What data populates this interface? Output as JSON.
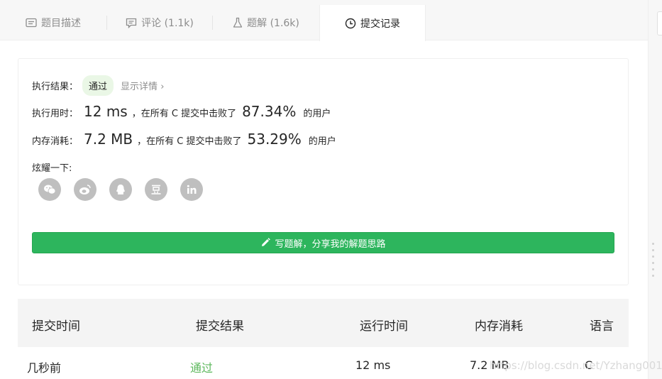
{
  "tabs": [
    {
      "label": "题目描述",
      "icon": "description-icon"
    },
    {
      "label": "评论 (1.1k)",
      "icon": "comment-icon"
    },
    {
      "label": "题解 (1.6k)",
      "icon": "flask-icon"
    },
    {
      "label": "提交记录",
      "icon": "clock-icon",
      "active": true
    }
  ],
  "result": {
    "exec_result_label": "执行结果：",
    "status": "通过",
    "show_detail": "显示详情",
    "runtime_label": "执行用时：",
    "runtime_value": "12 ms",
    "runtime_mid": "，在所有 C 提交中击败了",
    "runtime_percent": "87.34%",
    "runtime_tail": "的用户",
    "memory_label": "内存消耗：",
    "memory_value": "7.2 MB",
    "memory_mid": "，在所有 C 提交中击败了",
    "memory_percent": "53.29%",
    "memory_tail": "的用户",
    "share_label": "炫耀一下:",
    "share_icons": [
      "wechat-icon",
      "weibo-icon",
      "qq-icon",
      "douban-icon",
      "linkedin-icon"
    ],
    "write_solution": "写题解，分享我的解题思路"
  },
  "table": {
    "headers": [
      "提交时间",
      "提交结果",
      "运行时间",
      "内存消耗",
      "语言"
    ],
    "rows": [
      [
        "几秒前",
        "通过",
        "12 ms",
        "7.2 MB",
        "C"
      ]
    ]
  },
  "watermark": "https://blog.csdn.net/Yzhang001",
  "colors": {
    "accent_green": "#2db55d",
    "pass_text": "#5cb85c",
    "badge_bg": "#eaf7e6"
  }
}
